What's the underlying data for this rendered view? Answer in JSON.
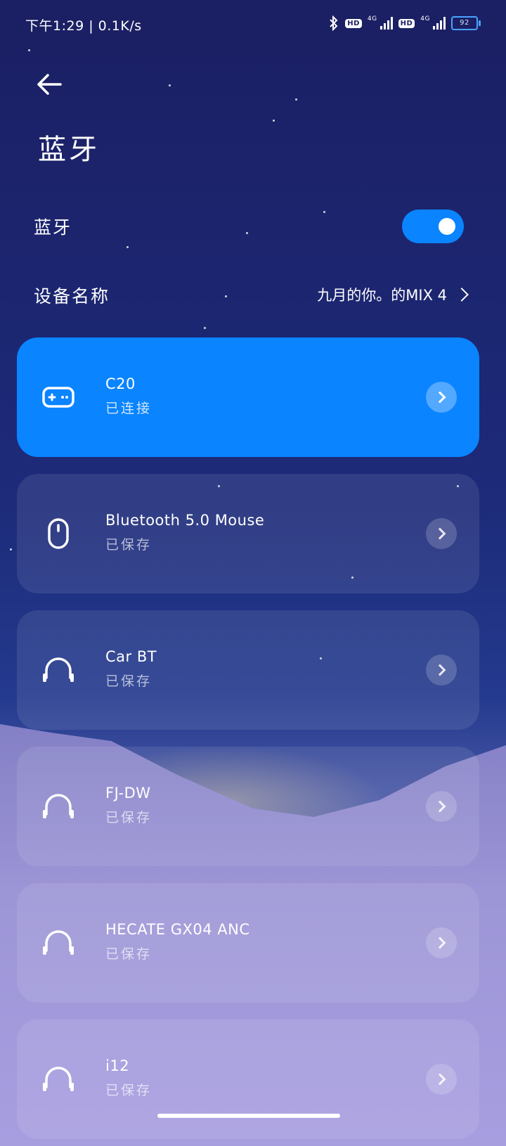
{
  "status_bar": {
    "time": "下午1:29",
    "speed": "0.1K/s",
    "hd1": "HD",
    "net1": "4G",
    "hd2": "HD",
    "net2": "4G",
    "battery": "92"
  },
  "page": {
    "title": "蓝牙"
  },
  "bluetooth": {
    "label": "蓝牙",
    "enabled": true
  },
  "device_name": {
    "label": "设备名称",
    "value": "九月的你。的MIX 4"
  },
  "devices": [
    {
      "name": "C20",
      "status": "已连接",
      "icon": "gamepad-icon",
      "active": true
    },
    {
      "name": "Bluetooth 5.0 Mouse",
      "status": "已保存",
      "icon": "mouse-icon",
      "active": false
    },
    {
      "name": "Car BT",
      "status": "已保存",
      "icon": "headphones-icon",
      "active": false
    },
    {
      "name": "FJ-DW",
      "status": "已保存",
      "icon": "headphones-icon",
      "active": false
    },
    {
      "name": "HECATE GX04 ANC",
      "status": "已保存",
      "icon": "headphones-icon",
      "active": false
    },
    {
      "name": "i12",
      "status": "已保存",
      "icon": "headphones-icon",
      "active": false
    }
  ],
  "colors": {
    "accent": "#0a84ff",
    "background_top": "#1b1f63",
    "background_bottom": "#a39ad8"
  }
}
